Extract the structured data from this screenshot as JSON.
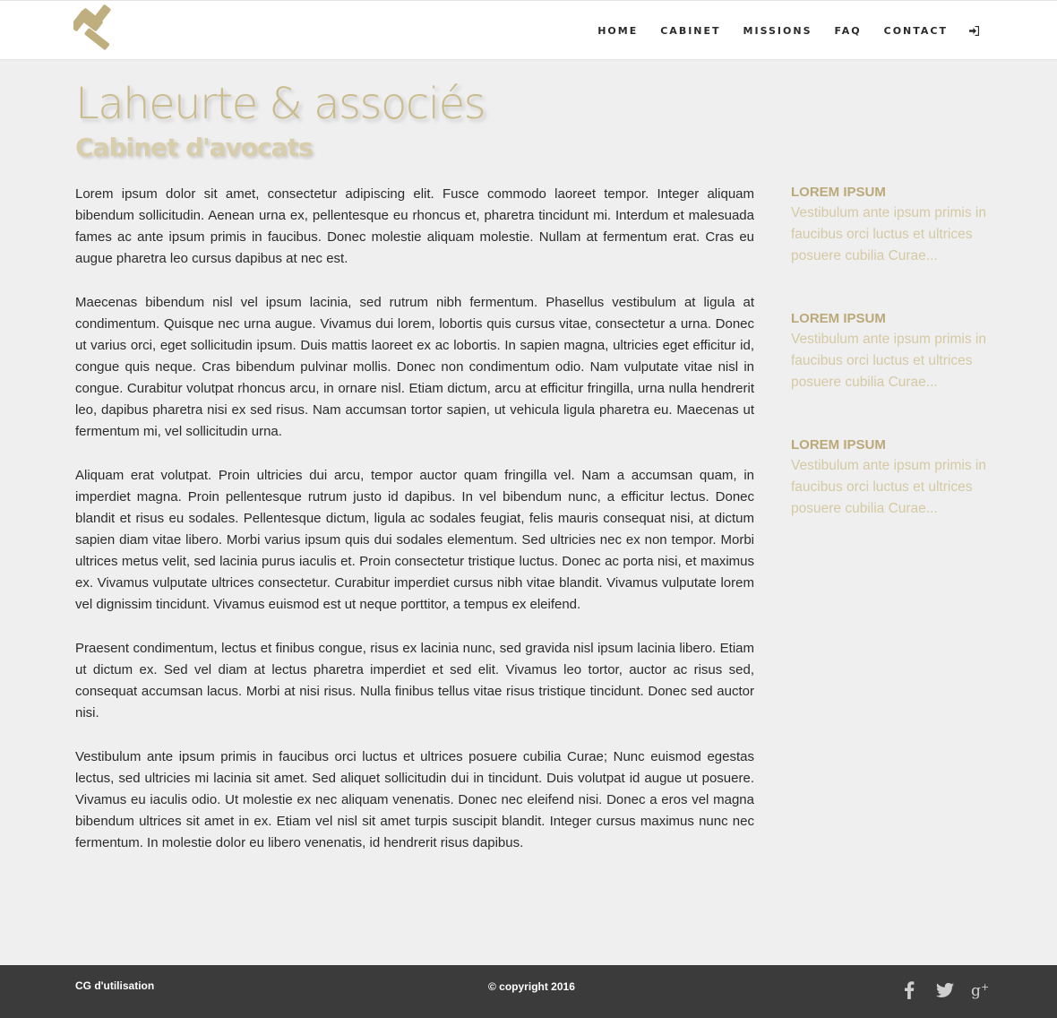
{
  "colors": {
    "accent": "#c9bb8c",
    "accent_dark": "#bba97a",
    "accent_light": "#d5c9a4",
    "background": "#efefef",
    "footer_bg": "#3b3b3b"
  },
  "header": {
    "logo_icon": "gavel-icon",
    "nav": [
      "HOME",
      "CABINET",
      "MISSIONS",
      "FAQ",
      "CONTACT"
    ],
    "login_icon": "sign-in-icon"
  },
  "hero": {
    "title": "Laheurte & associés",
    "subtitle": "Cabinet d'avocats"
  },
  "main": {
    "paragraphs": [
      "Lorem ipsum dolor sit amet, consectetur adipiscing elit. Fusce commodo laoreet tempor. Integer aliquam bibendum sollicitudin. Aenean urna ex, pellentesque eu rhoncus et, pharetra tincidunt mi. Interdum et malesuada fames ac ante ipsum primis in faucibus. Donec molestie aliquam molestie. Nullam at fermentum erat. Cras eu augue pharetra leo cursus dapibus at nec est.",
      "Maecenas bibendum nisl vel ipsum lacinia, sed rutrum nibh fermentum. Phasellus vestibulum at ligula at condimentum. Quisque nec urna augue. Vivamus dui lorem, lobortis quis cursus vitae, consectetur a urna. Donec ut varius orci, eget sollicitudin ipsum. Duis mattis laoreet ex ac lobortis. In sapien magna, ultricies eget efficitur id, congue quis neque. Cras bibendum pulvinar mollis. Donec non condimentum odio. Nam vulputate vitae nisl in congue. Curabitur volutpat rhoncus arcu, in ornare nisl. Etiam dictum, arcu at efficitur fringilla, urna nulla hendrerit leo, dapibus pharetra nisi ex sed risus. Nam accumsan tortor sapien, ut vehicula ligula pharetra eu. Maecenas ut fermentum mi, vel sollicitudin urna.",
      "Aliquam erat volutpat. Proin ultricies dui arcu, tempor auctor quam fringilla vel. Nam a accumsan quam, in imperdiet magna. Proin pellentesque rutrum justo id dapibus. In vel bibendum nunc, a efficitur lectus. Donec blandit et risus eu sodales. Pellentesque dictum, ligula ac sodales feugiat, felis mauris consequat nisi, at dictum sapien diam vitae libero. Morbi varius ipsum quis dui sodales elementum. Sed ultricies nec ex non tempor. Morbi ultrices metus velit, sed lacinia purus iaculis et. Proin consectetur tristique luctus. Donec ac porta nisi, et maximus ex. Vivamus vulputate ultrices consectetur. Curabitur imperdiet cursus nibh vitae blandit. Vivamus vulputate lorem vel dignissim tincidunt. Vivamus euismod est ut neque porttitor, a tempus ex eleifend.",
      "Praesent condimentum, lectus et finibus congue, risus ex lacinia nunc, sed gravida nisl ipsum lacinia libero. Etiam ut dictum ex. Sed vel diam at lectus pharetra imperdiet et sed elit. Vivamus leo tortor, auctor ac risus sed, consequat accumsan lacus. Morbi at nisi risus. Nulla finibus tellus vitae risus tristique tincidunt. Donec sed auctor nisi.",
      "Vestibulum ante ipsum primis in faucibus orci luctus et ultrices posuere cubilia Curae; Nunc euismod egestas lectus, sed ultricies mi lacinia sit amet. Sed aliquet sollicitudin dui in tincidunt. Duis volutpat id augue ut posuere. Vivamus eu iaculis odio. Ut molestie ex nec aliquam venenatis. Donec nec eleifend nisi. Donec a eros vel magna bibendum ultrices sit amet in ex. Etiam vel nisl sit amet turpis suscipit blandit. Integer cursus maximus nunc nec fermentum. In molestie dolor eu libero venenatis, id hendrerit risus dapibus."
    ]
  },
  "sidebar": {
    "items": [
      {
        "title": "LOREM IPSUM",
        "text": "Vestibulum ante ipsum primis in faucibus orci luctus et ultrices posuere cubilia Curae..."
      },
      {
        "title": "LOREM IPSUM",
        "text": "Vestibulum ante ipsum primis in faucibus orci luctus et ultrices posuere cubilia Curae..."
      },
      {
        "title": "LOREM IPSUM",
        "text": "Vestibulum ante ipsum primis in faucibus orci luctus et ultrices posuere cubilia Curae..."
      }
    ]
  },
  "footer": {
    "terms": "CG d'utilisation",
    "copyright": "© copyright 2016",
    "social": [
      "facebook-icon",
      "twitter-icon",
      "google-plus-icon"
    ]
  }
}
